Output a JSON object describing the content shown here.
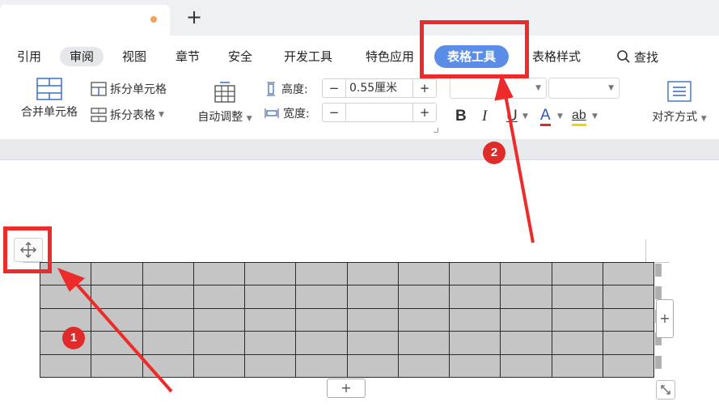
{
  "tabbar": {
    "new_tab_label": "+"
  },
  "menu": {
    "items": [
      "引用",
      "审阅",
      "视图",
      "章节",
      "安全",
      "开发工具",
      "特色应用",
      "表格工具",
      "表格样式"
    ],
    "search_label": "查找"
  },
  "ribbon": {
    "merge_cells": "合并单元格",
    "split_cells": "拆分单元格",
    "split_table": "拆分表格",
    "auto_adjust": "自动调整",
    "height_label": "高度:",
    "height_value": "0.55厘米",
    "width_label": "宽度:",
    "width_value": "",
    "minus": "−",
    "plus": "+",
    "bold": "B",
    "italic": "I",
    "underline": "U",
    "font_color": "A",
    "highlight": "ab",
    "align": "对齐方式"
  },
  "table": {
    "rows": 5,
    "cols": 12
  },
  "document": {
    "add_label": "+"
  },
  "annotations": {
    "badge1": "1",
    "badge2": "2"
  },
  "colors": {
    "accent": "#5a8de8",
    "highlight": "#ee2b2b",
    "table_fill": "#c5c5c5"
  }
}
